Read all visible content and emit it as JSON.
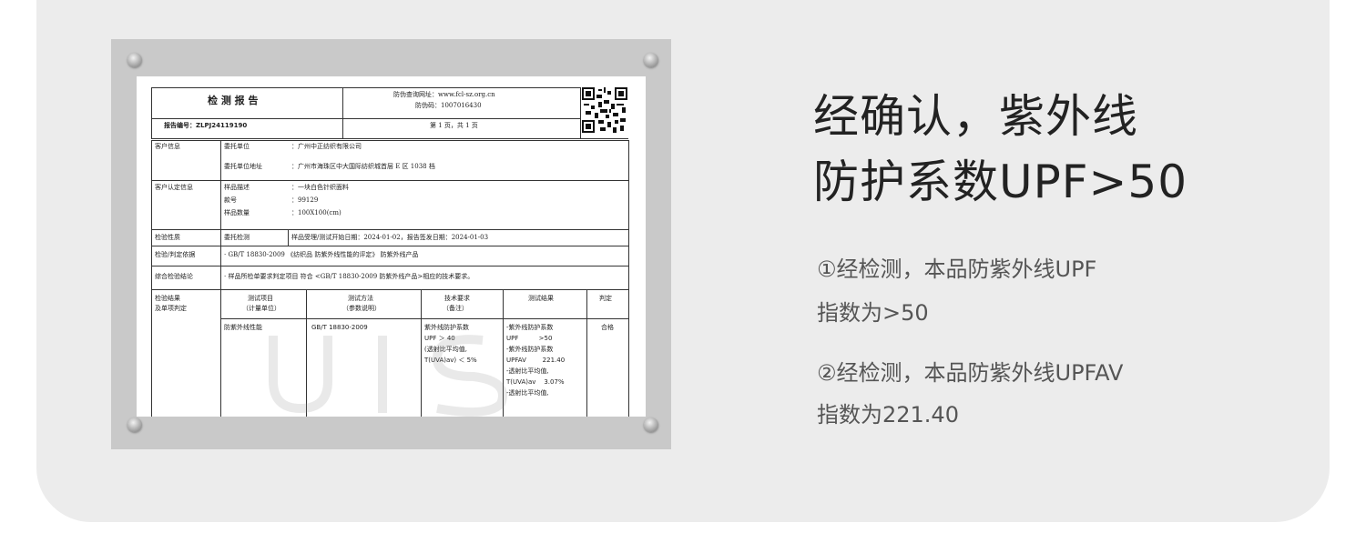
{
  "headline": {
    "line1": "经确认，紫外线",
    "line2": "防护系数UPF>50"
  },
  "notes": [
    {
      "line1": "①经检测，本品防紫外线UPF",
      "line2": "指数为>50"
    },
    {
      "line1": "②经检测，本品防紫外线UPFAV",
      "line2": "指数为221.40"
    }
  ],
  "report": {
    "title": "检 测 报 告",
    "report_no": "报告编号：ZLPJ24119190",
    "verify_url": "防伪查询网址：www.fcl-sz.org.cn",
    "verify_code": "防伪码：1007016430",
    "page": "第 1 页，共 1 页",
    "client_label": "客户信息",
    "client_rows": [
      {
        "k": "委托单位",
        "v": "：广州中正纺织有限公司"
      },
      {
        "k": "委托单位地址",
        "v": "：广州市海珠区中大国际纺织城首层 E 区 1038 档"
      }
    ],
    "sample_label": "客户认定信息",
    "sample_rows": [
      {
        "k": "样品描述",
        "v": "：一块白色针织面料"
      },
      {
        "k": "款号",
        "v": "：99129"
      },
      {
        "k": "样品数量",
        "v": "：100X100(cm)"
      }
    ],
    "nature_label": "检验性质",
    "nature_value": "委托检测",
    "dates": "样品受理/测试开始日期：2024-01-02，报告签发日期：2024-01-03",
    "basis_label": "检验/判定依据",
    "basis_value": "· GB/T 18830-2009 《纺织品 防紫外线性能的评定》 防紫外线产品",
    "conclusion_label": "综合检验结论",
    "conclusion_value": "· 样品所检单要求判定项目 符合 <GB/T 18830-2009 防紫外线产品>相应的技术要求。",
    "result_label": [
      "检验结果",
      "及单项判定"
    ],
    "headers": [
      [
        "测试项目",
        "（计量单位）"
      ],
      [
        "测试方法",
        "（参数说明）"
      ],
      [
        "技术要求",
        "（备注）"
      ],
      [
        "测试结果",
        ""
      ],
      [
        "判定",
        ""
      ]
    ],
    "item": "防紫外线性能",
    "method": "GB/T 18830-2009",
    "requirement": [
      "紫外线防护系数",
      "UPF ＞ 40",
      "(透射比平均值,",
      "T(UVA)av) ＜ 5%"
    ],
    "result": [
      "-紫外线防护系数",
      "UPF          >50",
      "-紫外线防护系数",
      "UPFAV        221.40",
      "-透射比平均值,",
      "T(UVA)av    3.07%",
      "-透射比平均值,"
    ],
    "verdict": "合格"
  }
}
